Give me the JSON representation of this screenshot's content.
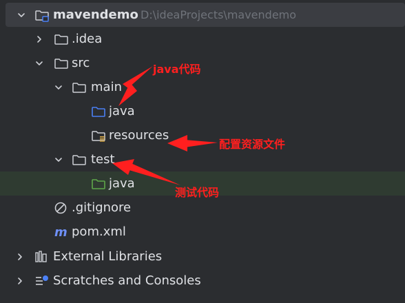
{
  "project": {
    "name": "mavendemo",
    "path": "D:\\ideaProjects\\mavendemo"
  },
  "tree": {
    "idea": ".idea",
    "src": "src",
    "main": "main",
    "main_java": "java",
    "resources": "resources",
    "test": "test",
    "test_java": "java",
    "gitignore": ".gitignore",
    "pom": "pom.xml",
    "external_libraries": "External Libraries",
    "scratches": "Scratches and Consoles"
  },
  "annotations": {
    "java_code": "java代码",
    "resources_note": "配置资源文件",
    "test_code": "测试代码"
  },
  "colors": {
    "background": "#2b2d30",
    "text": "#dfe1e5",
    "muted": "#6f737a",
    "source_folder": "#4b80f5",
    "test_folder": "#5fa84a",
    "annotation": "#ff1f1f"
  }
}
